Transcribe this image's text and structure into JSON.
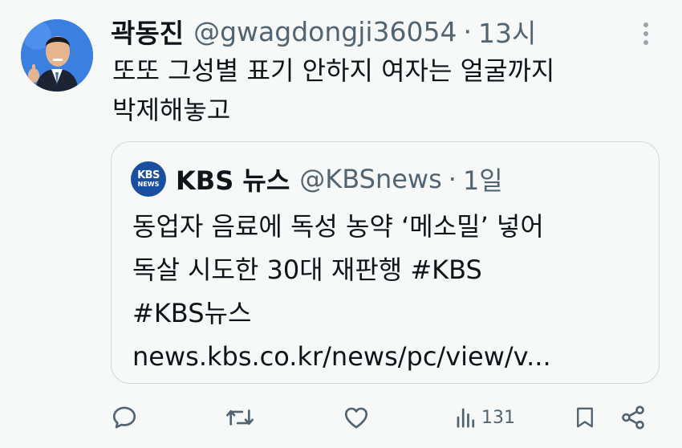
{
  "tweet": {
    "author_name": "곽동진",
    "author_handle": "@gwagdongji36054",
    "separator": "·",
    "time": "13시",
    "text_lines": [
      "또또 그성별 표기 안하지 여자는 얼굴까지",
      "박제해놓고"
    ]
  },
  "quoted": {
    "logo_line1": "KBS",
    "logo_line2": "NEWS",
    "author_name": "KBS 뉴스",
    "author_handle": "@KBSnews",
    "separator": "·",
    "time": "1일",
    "text_lines": [
      "동업자 음료에 독성 농약 ‘메소밀’ 넣어",
      "독살 시도한 30대 재판행 #KBS",
      "#KBS뉴스",
      "news.kbs.co.kr/news/pc/view/v..."
    ]
  },
  "actions": {
    "views": "131"
  },
  "icons": [
    "more-icon",
    "reply-icon",
    "retweet-icon",
    "like-icon",
    "views-icon",
    "bookmark-icon",
    "share-icon"
  ],
  "colors": {
    "background": "#f7f9f9",
    "text": "#0f1419",
    "secondary": "#536471",
    "border": "#cfd9de",
    "kbs_blue": "#1a4fa0"
  }
}
